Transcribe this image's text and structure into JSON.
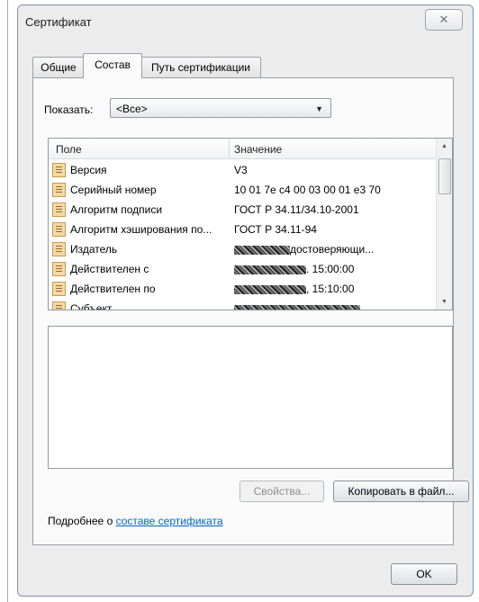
{
  "window": {
    "title": "Сертификат",
    "close_symbol": "✕"
  },
  "tabs": [
    {
      "label": "Общие"
    },
    {
      "label": "Состав",
      "active": true
    },
    {
      "label": "Путь сертификации"
    }
  ],
  "show": {
    "label": "Показать:",
    "selected": "<Все>"
  },
  "list": {
    "columns": [
      "Поле",
      "Значение"
    ],
    "rows": [
      {
        "field": "Версия",
        "value": "V3"
      },
      {
        "field": "Серийный номер",
        "value": "10 01 7e c4 00 03 00 01 e3 70"
      },
      {
        "field": "Алгоритм подписи",
        "value": "ГОСТ Р 34.11/34.10-2001"
      },
      {
        "field": "Алгоритм хэширования по...",
        "value": "ГОСТ Р 34.11-94"
      },
      {
        "field": "Издатель",
        "value": "достоверяющи..."
      },
      {
        "field": "Действителен с",
        "value": ". 15:00:00"
      },
      {
        "field": "Действителен по",
        "value": ", 15:10:00"
      },
      {
        "field": "Субъект",
        "value": ""
      }
    ]
  },
  "buttons": {
    "properties": "Свойства...",
    "copy_to_file": "Копировать в файл...",
    "ok": "OK"
  },
  "more": {
    "prefix": "Подробнее о ",
    "link": "составе сертификата"
  }
}
